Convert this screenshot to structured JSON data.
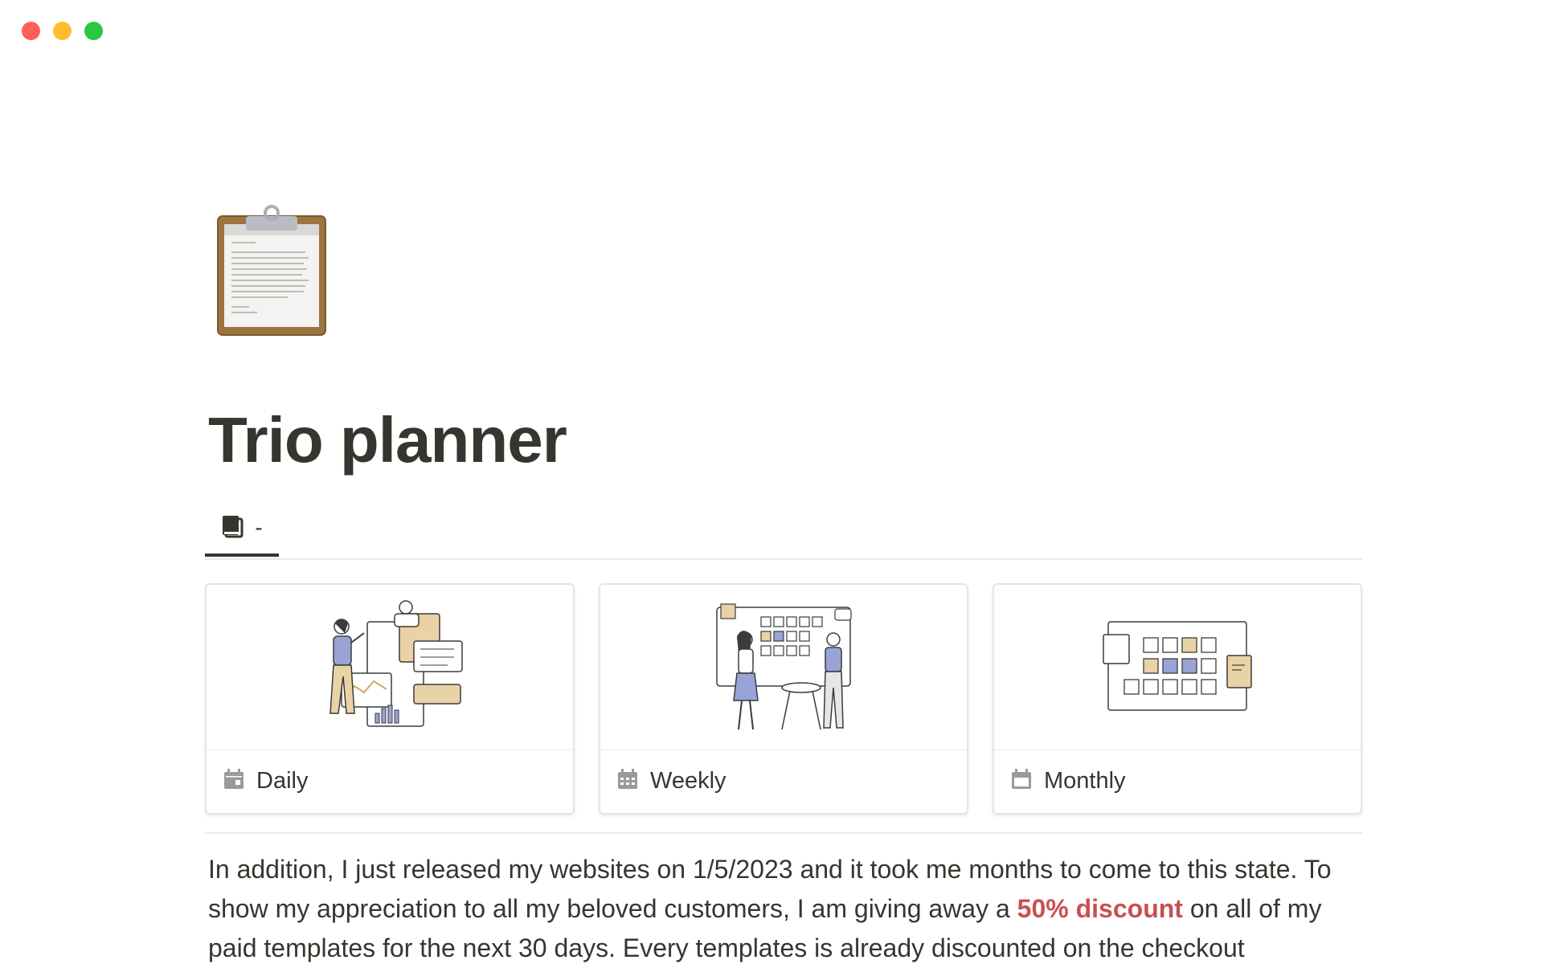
{
  "window": {
    "controls": [
      "close",
      "minimize",
      "maximize"
    ]
  },
  "page": {
    "icon": "clipboard-icon",
    "title": "Trio planner"
  },
  "tabs": [
    {
      "label": "-",
      "icon": "book-icon",
      "active": true
    }
  ],
  "gallery": {
    "cards": [
      {
        "title": "Daily",
        "icon": "calendar-icon",
        "cover": "illustration-team-analytics"
      },
      {
        "title": "Weekly",
        "icon": "calendar-grid-icon",
        "cover": "illustration-planning-board"
      },
      {
        "title": "Monthly",
        "icon": "calendar-month-icon",
        "cover": "illustration-month-board"
      }
    ]
  },
  "body": {
    "text_before": "In addition, I just released my websites on 1/5/2023 and it took me months to come to this state. To show my appreciation to all my beloved customers, I am giving away a ",
    "highlight": "50% discount",
    "text_after": " on all of my paid templates for the next 30 days. Every templates is already discounted on the checkout"
  },
  "colors": {
    "text": "#37352f",
    "highlight": "#c94f4f",
    "divider": "#e9e9e7",
    "close": "#fe5f57",
    "minimize": "#febc2e",
    "maximize": "#28c840"
  }
}
